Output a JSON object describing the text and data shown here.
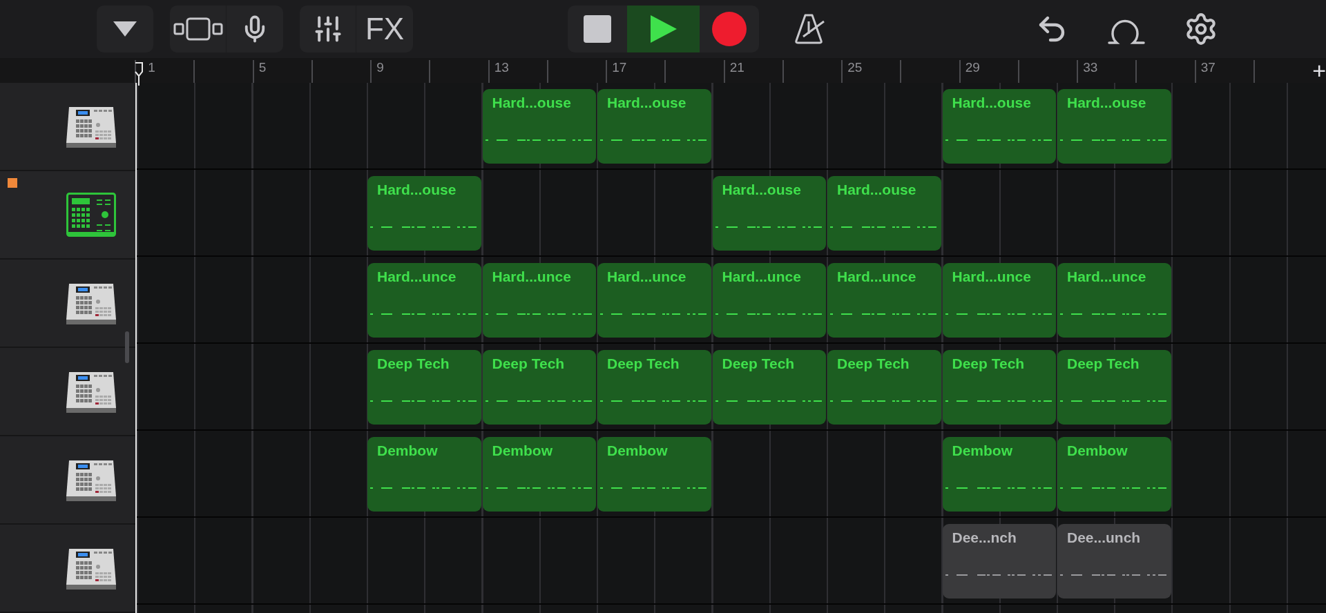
{
  "toolbar": {
    "fx_label": "FX",
    "transport": {
      "playing": true
    }
  },
  "ruler": {
    "add_label": "+",
    "bar_numbers": [
      "1",
      "5",
      "9",
      "13",
      "17",
      "21",
      "25",
      "29",
      "33",
      "37"
    ]
  },
  "tracks": [
    {
      "selected": false,
      "slots": [
        {
          "kind": "empty"
        },
        {
          "kind": "region",
          "title": "Hard...ouse",
          "muted": false
        },
        {
          "kind": "region",
          "title": "Hard...ouse",
          "muted": false
        },
        {
          "kind": "empty"
        },
        {
          "kind": "empty"
        },
        {
          "kind": "region",
          "title": "Hard...ouse",
          "muted": false
        },
        {
          "kind": "region",
          "title": "Hard...ouse",
          "muted": false
        }
      ]
    },
    {
      "selected": true,
      "slots": [
        {
          "kind": "region",
          "title": "Hard...ouse",
          "muted": false
        },
        {
          "kind": "empty"
        },
        {
          "kind": "empty"
        },
        {
          "kind": "region",
          "title": "Hard...ouse",
          "muted": false
        },
        {
          "kind": "region",
          "title": "Hard...ouse",
          "muted": false
        },
        {
          "kind": "empty"
        },
        {
          "kind": "empty"
        }
      ]
    },
    {
      "selected": false,
      "slots": [
        {
          "kind": "region",
          "title": "Hard...unce",
          "muted": false
        },
        {
          "kind": "region",
          "title": "Hard...unce",
          "muted": false
        },
        {
          "kind": "region",
          "title": "Hard...unce",
          "muted": false
        },
        {
          "kind": "region",
          "title": "Hard...unce",
          "muted": false
        },
        {
          "kind": "region",
          "title": "Hard...unce",
          "muted": false
        },
        {
          "kind": "region",
          "title": "Hard...unce",
          "muted": false
        },
        {
          "kind": "region",
          "title": "Hard...unce",
          "muted": false
        }
      ]
    },
    {
      "selected": false,
      "slots": [
        {
          "kind": "region",
          "title": "Deep Tech",
          "muted": false
        },
        {
          "kind": "region",
          "title": "Deep Tech",
          "muted": false
        },
        {
          "kind": "region",
          "title": "Deep Tech",
          "muted": false
        },
        {
          "kind": "region",
          "title": "Deep Tech",
          "muted": false
        },
        {
          "kind": "region",
          "title": "Deep Tech",
          "muted": false
        },
        {
          "kind": "region",
          "title": "Deep Tech",
          "muted": false
        },
        {
          "kind": "region",
          "title": "Deep Tech",
          "muted": false
        }
      ]
    },
    {
      "selected": false,
      "slots": [
        {
          "kind": "region",
          "title": "Dembow",
          "muted": false
        },
        {
          "kind": "region",
          "title": "Dembow",
          "muted": false
        },
        {
          "kind": "region",
          "title": "Dembow",
          "muted": false
        },
        {
          "kind": "empty"
        },
        {
          "kind": "empty"
        },
        {
          "kind": "region",
          "title": "Dembow",
          "muted": false
        },
        {
          "kind": "region",
          "title": "Dembow",
          "muted": false
        }
      ]
    },
    {
      "selected": false,
      "slots": [
        {
          "kind": "empty"
        },
        {
          "kind": "empty"
        },
        {
          "kind": "empty"
        },
        {
          "kind": "empty"
        },
        {
          "kind": "empty"
        },
        {
          "kind": "region",
          "title": "Dee...nch",
          "muted": true
        },
        {
          "kind": "region",
          "title": "Dee...unch",
          "muted": true
        }
      ]
    }
  ]
}
